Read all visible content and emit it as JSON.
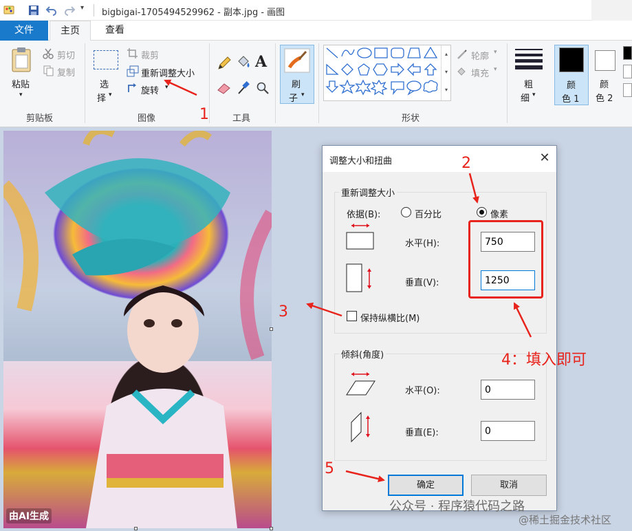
{
  "window": {
    "title": "bigbigai-1705494529962 - 副本.jpg - 画图"
  },
  "tabs": [
    {
      "label": "文件"
    },
    {
      "label": "主页"
    },
    {
      "label": "查看"
    }
  ],
  "ribbon": {
    "clipboard": {
      "paste": "粘贴",
      "cut": "剪切",
      "copy": "复制",
      "group": "剪贴板"
    },
    "image": {
      "select_1": "选",
      "select_2": "择",
      "crop": "裁剪",
      "resize": "重新调整大小",
      "rotate": "旋转",
      "group": "图像"
    },
    "tools": {
      "group": "工具",
      "text_icon": "A"
    },
    "brushes": {
      "line1": "刷",
      "line2": "子"
    },
    "shapes": {
      "group": "形状",
      "outline": "轮廓",
      "fill": "填充"
    },
    "size": {
      "line1": "粗",
      "line2": "细"
    },
    "color1": {
      "line1": "颜",
      "line2": "色 1"
    },
    "color2": {
      "line1": "颜",
      "line2": "色 2"
    }
  },
  "dialog": {
    "title": "调整大小和扭曲",
    "resize_group": "重新调整大小",
    "by_label": "依据(B):",
    "percent_label": "百分比",
    "pixels_label": "像素",
    "selected_unit": "像素",
    "horizontal_label": "水平(H):",
    "horizontal_value": "750",
    "vertical_label": "垂直(V):",
    "vertical_value": "1250",
    "keep_ratio_label": "保持纵横比(M)",
    "keep_ratio_checked": false,
    "skew_group": "倾斜(角度)",
    "skew_h_label": "水平(O):",
    "skew_h_value": "0",
    "skew_v_label": "垂直(E):",
    "skew_v_value": "0",
    "ok": "确定",
    "cancel": "取消"
  },
  "annotations": {
    "n1": "1",
    "n2": "2",
    "n3": "3",
    "n4": "4：填入即可",
    "n5": "5",
    "color": "#e8231c"
  },
  "watermarks": {
    "left": "由AI生成",
    "wechat": "公众号 · 程序猿代码之路",
    "juejin": "@稀土掘金技术社区"
  },
  "colors": {
    "file_tab": "#1979ca",
    "focus_blue": "#0078d7",
    "canvas_bg": "#c9d4e4"
  },
  "icons": [
    "paint-app-icon",
    "save-icon",
    "undo-icon",
    "redo-icon",
    "paste-icon",
    "cut-icon",
    "copy-icon",
    "select-icon",
    "crop-icon",
    "resize-icon",
    "rotate-icon",
    "pencil-icon",
    "fill-bucket-icon",
    "text-icon",
    "eraser-icon",
    "color-picker-icon",
    "magnifier-icon",
    "brush-icon",
    "size-icon",
    "close-icon"
  ]
}
